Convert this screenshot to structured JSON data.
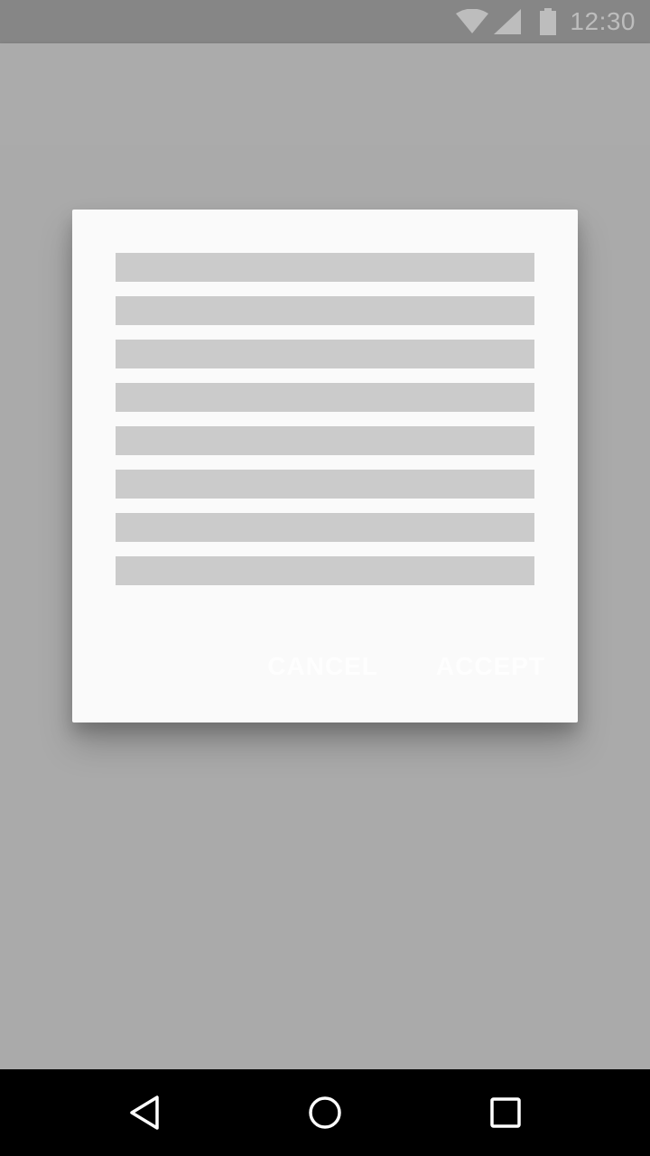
{
  "status_bar": {
    "time": "12:30",
    "icons": [
      "wifi-icon",
      "cellular-signal-icon",
      "battery-icon"
    ],
    "icon_color": "#bdbdbd"
  },
  "app_bar": {
    "color": "#ababab"
  },
  "dialog": {
    "placeholder_line_count": 8,
    "line_color": "#cbcbcb",
    "actions": [
      {
        "label": "CANCEL"
      },
      {
        "label": "ACCEPT"
      }
    ]
  },
  "nav_bar": {
    "buttons": [
      "back-icon",
      "home-icon",
      "recents-icon"
    ]
  }
}
